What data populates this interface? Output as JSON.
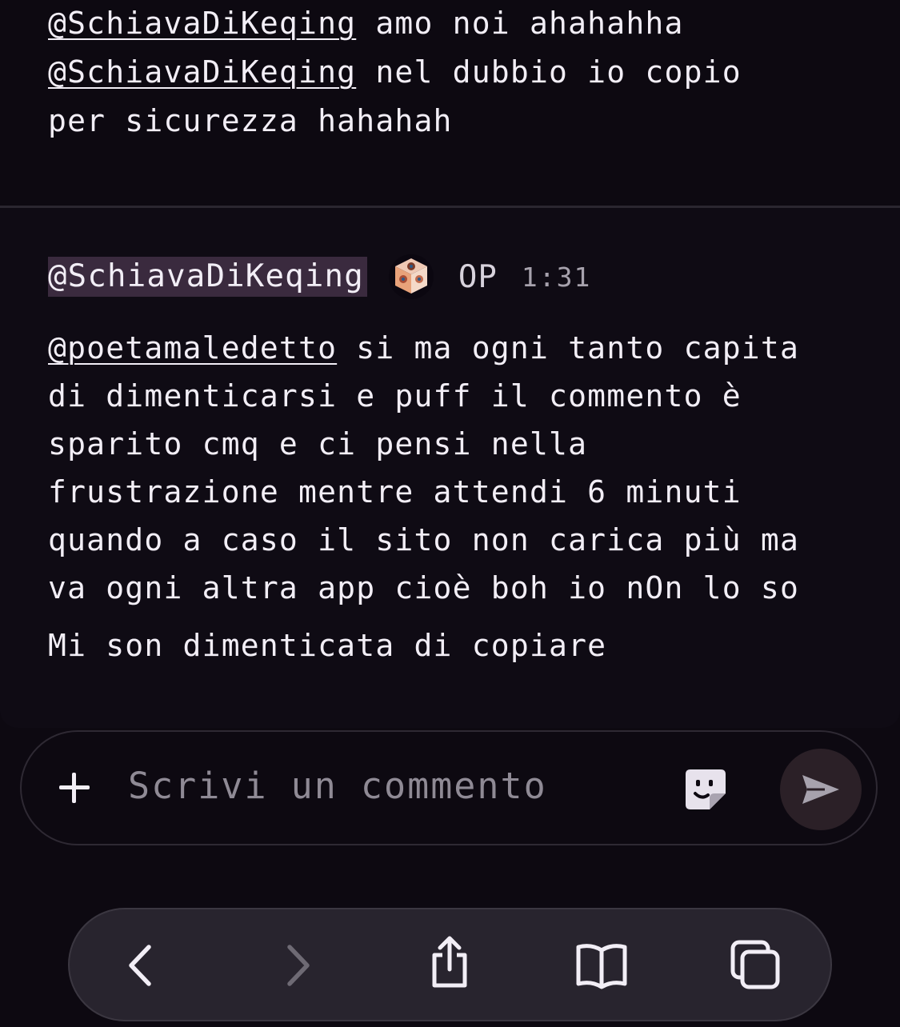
{
  "previous_comment": {
    "lines": [
      {
        "mention": "@SchiavaDiKeqing",
        "text": " amo noi ahahahha"
      },
      {
        "mention": "@SchiavaDiKeqing",
        "text": " nel dubbio io copio"
      },
      {
        "mention": "",
        "text": "per sicurezza hahahah"
      }
    ]
  },
  "comment": {
    "author": "@SchiavaDiKeqing",
    "avatar_icon": "cube-avatar-icon",
    "badge": "OP",
    "time": "1:31",
    "mention": "@poetamaledetto",
    "first_line_rest": " si ma ogni tanto capita",
    "body_lines": [
      "di dimenticarsi e puff il commento è",
      "sparito cmq e ci pensi nella",
      "frustrazione mentre attendi 6 minuti",
      "quando a caso il sito non carica più ma",
      "va ogni altra app cioè boh io nOn lo so"
    ],
    "reply_line": "Mi son dimenticata di copiare"
  },
  "composer": {
    "placeholder": "Scrivi un commento",
    "add_icon": "plus-icon",
    "sticker_icon": "sticker-icon",
    "send_icon": "send-icon"
  },
  "browser_toolbar": {
    "items": [
      "back-icon",
      "forward-icon",
      "share-icon",
      "bookmarks-icon",
      "tabs-icon"
    ]
  },
  "colors": {
    "background": "#0d0911",
    "text": "#f2eef6",
    "author_highlight": "#3a2a3e",
    "send_button": "#2b2027",
    "toolbar": "#28242e"
  }
}
